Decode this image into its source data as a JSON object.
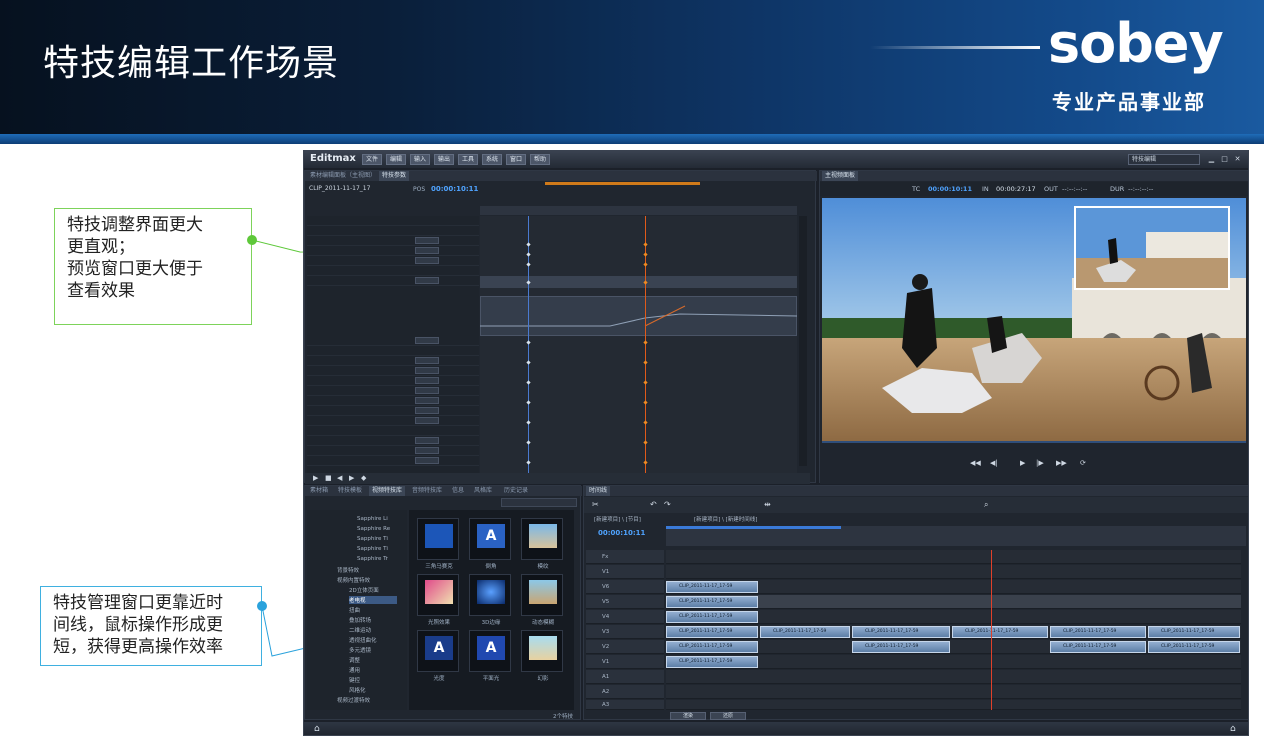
{
  "slide": {
    "title": "特技编辑工作场景",
    "logo_text": "sobey",
    "logo_subtitle": "专业产品事业部"
  },
  "callouts": {
    "top": [
      "特技调整界面更大",
      "更直观；",
      "预览窗口更大便于",
      "查看效果"
    ],
    "bottom": [
      "特技管理窗口更靠近时",
      "间线，鼠标操作形成更",
      "短，获得更高操作效率"
    ]
  },
  "app": {
    "name": "Editmax",
    "menus": [
      "文件",
      "编辑",
      "输入",
      "输出",
      "工具",
      "系统",
      "窗口",
      "帮助"
    ],
    "preset": "特技编辑",
    "effect_panel": {
      "tabs": [
        "素材编辑面板（主视图）",
        "特技参数"
      ],
      "clip_name": "CLIP_2011-11-17_17",
      "pos_label": "POS",
      "pos_value": "00:00:10:11"
    },
    "preview_panel": {
      "tab": "主视频面板",
      "tc_label": "TC",
      "tc_value": "00:00:10:11",
      "in_label": "IN",
      "in_value": "00:00:27:17",
      "out_label": "OUT",
      "out_value": "--:--:--:--",
      "dur_label": "DUR",
      "dur_value": "--:--:--:--"
    },
    "library_panel": {
      "tabs": [
        "素材箱",
        "特技模板",
        "视频特技库",
        "音频特技库",
        "信息",
        "风格库",
        "历史记录"
      ],
      "tree": [
        "Sapphire Li",
        "Sapphire Re",
        "Sapphire Ti",
        "Sapphire Ti",
        "Sapphire Tr",
        "背景特效",
        "视频内置特效",
        "2D立体页面",
        "老电视",
        "扭曲",
        "叠加转场",
        "二维运动",
        "透视扭曲化",
        "多元透镜",
        "调整",
        "通用",
        "键控",
        "风格化",
        "视频过渡特效"
      ],
      "thumbs": [
        {
          "label": "三角马赛克",
          "icon": "mosaic-icon"
        },
        {
          "label": "倒角",
          "icon": "bevel-icon"
        },
        {
          "label": "模纹",
          "icon": "pattern-icon"
        },
        {
          "label": "光照效果",
          "icon": "lighting-icon"
        },
        {
          "label": "3D边缘",
          "icon": "edge-icon"
        },
        {
          "label": "动态模糊",
          "icon": "blur-icon"
        },
        {
          "label": "光度",
          "icon": "luminance-icon"
        },
        {
          "label": "平面光",
          "icon": "flat-light-icon"
        },
        {
          "label": "幻影",
          "icon": "phantom-icon"
        }
      ],
      "count": "2个特技"
    },
    "timeline_panel": {
      "tab": "时间线",
      "path": "[新建项目] \\ [节目]",
      "sequence": "[新建项目] \\ [新建时间线]",
      "tc_value": "00:00:10:11",
      "tracks": [
        "Fx",
        "V1",
        "V6",
        "V5",
        "V4",
        "V3",
        "V2",
        "V1",
        "A1",
        "A2",
        "A3"
      ],
      "clip_label": "CLIP_2011-11-17_17-59",
      "buttons": [
        "渲染",
        "还原"
      ]
    }
  }
}
